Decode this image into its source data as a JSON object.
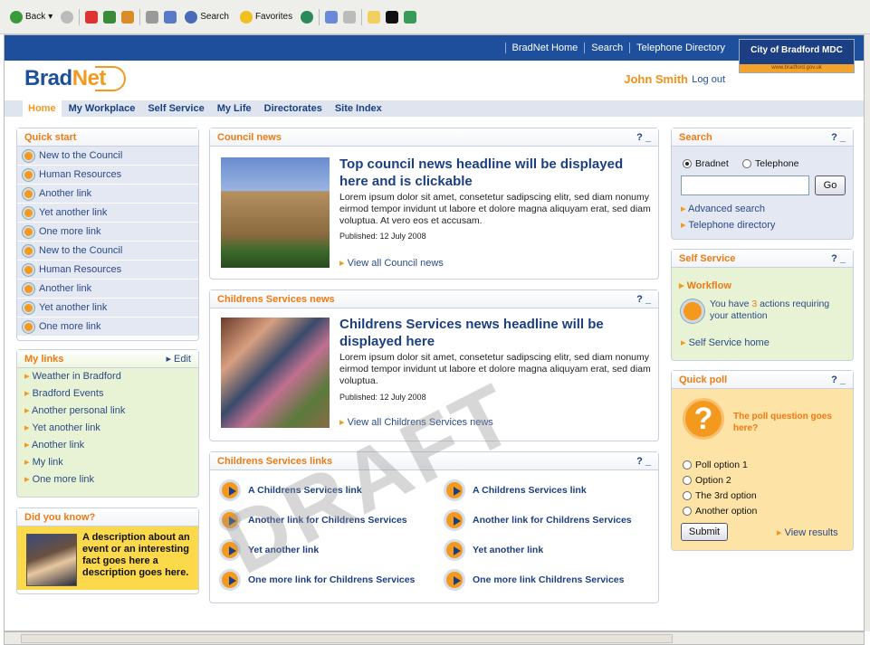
{
  "toolbar": {
    "back": "Back",
    "search": "Search",
    "favorites": "Favorites"
  },
  "toplinks": [
    "BradNet Home",
    "Search",
    "Telephone Directory"
  ],
  "council": {
    "name": "City of Bradford MDC",
    "url": "www.bradford.gov.uk"
  },
  "logo": {
    "brad": "Brad",
    "net": "Net"
  },
  "user": {
    "name": "John Smith",
    "logout": "Log out"
  },
  "nav": [
    "Home",
    "My Workplace",
    "Self Service",
    "My Life",
    "Directorates",
    "Site Index"
  ],
  "quickstart": {
    "title": "Quick start",
    "items": [
      "New to the Council",
      "Human Resources",
      "Another link",
      "Yet another link",
      "One more link",
      "New to the Council",
      "Human Resources",
      "Another link",
      "Yet another link",
      "One more link"
    ]
  },
  "mylinks": {
    "title": "My links",
    "edit": "Edit",
    "items": [
      "Weather in Bradford",
      "Bradford Events",
      "Another personal link",
      "Yet another link",
      "Another link",
      "My link",
      "One more link"
    ]
  },
  "didyouknow": {
    "title": "Did you know?",
    "text": "A description about an event or an interesting fact goes here a description goes here."
  },
  "council_news": {
    "title": "Council news",
    "ctl": "? _",
    "headline": "Top council news headline will be displayed here and is clickable",
    "body": "Lorem ipsum dolor sit amet, consetetur sadipscing elitr, sed diam nonumy eirmod tempor invidunt ut labore et dolore magna aliquyam erat, sed diam voluptua. At vero eos et accusam.",
    "published": "Published: 12 July 2008",
    "viewall": "View all Council news"
  },
  "children_news": {
    "title": "Childrens Services news",
    "ctl": "? _",
    "headline": "Childrens Services news headline will be displayed here",
    "body": "Lorem ipsum dolor sit amet, consetetur sadipscing elitr, sed diam nonumy eirmod tempor invidunt ut labore et dolore magna aliquyam erat, sed diam voluptua.",
    "published": "Published: 12 July 2008",
    "viewall": "View all Childrens Services news"
  },
  "cs_links": {
    "title": "Childrens Services links",
    "ctl": "? _",
    "left": [
      "A Childrens Services link",
      "Another link for Childrens Services",
      "Yet another link",
      "One more link for Childrens Services"
    ],
    "right": [
      "A Childrens Services link",
      "Another link for Childrens Services",
      "Yet another link",
      "One more link Childrens Services"
    ]
  },
  "search": {
    "title": "Search",
    "ctl": "? _",
    "opt1": "Bradnet",
    "opt2": "Telephone",
    "go": "Go",
    "adv": "Advanced search",
    "tel": "Telephone directory"
  },
  "selfservice": {
    "title": "Self Service",
    "ctl": "? _",
    "workflow": "Workflow",
    "msg_pre": "You have ",
    "count": "3",
    "msg_post": " actions requiring your attention",
    "home": "Self Service home"
  },
  "poll": {
    "title": "Quick poll",
    "ctl": "? _",
    "question": "The poll question goes here?",
    "options": [
      "Poll option 1",
      "Option 2",
      "The 3rd option",
      "Another option"
    ],
    "submit": "Submit",
    "results": "View results",
    "mark": "?"
  },
  "watermark": "DRAFT"
}
